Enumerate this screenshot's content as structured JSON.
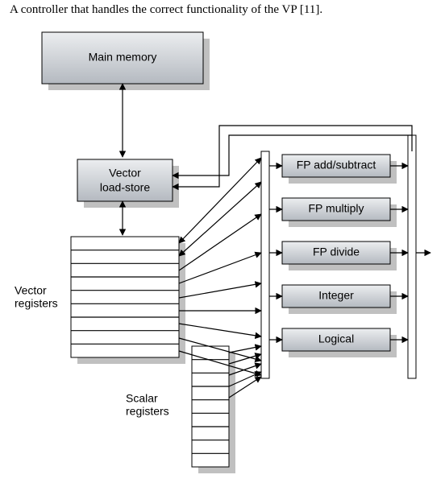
{
  "caption": "A controller that handles the correct functionality of the VP [11].",
  "blocks": {
    "main_memory": "Main memory",
    "vector_load_store_line1": "Vector",
    "vector_load_store_line2": "load-store",
    "fp_add": "FP add/subtract",
    "fp_mul": "FP multiply",
    "fp_div": "FP divide",
    "integer": "Integer",
    "logical": "Logical"
  },
  "labels": {
    "vector_registers_line1": "Vector",
    "vector_registers_line2": "registers",
    "scalar_registers_line1": "Scalar",
    "scalar_registers_line2": "registers"
  }
}
